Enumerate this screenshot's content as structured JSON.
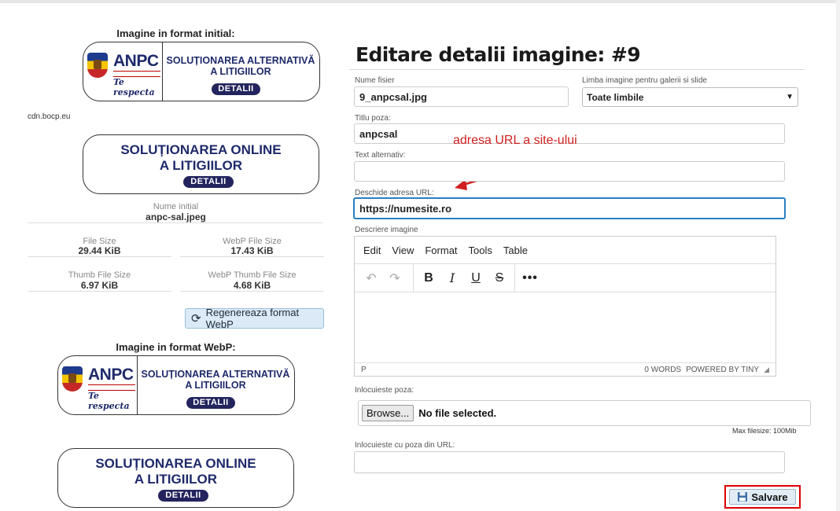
{
  "left": {
    "initial_heading": "Imagine in format initial:",
    "cdn_label": "cdn.bocp.eu",
    "banner1": {
      "brand": "ANPC",
      "tagline": "Te respecta",
      "title_line1": "SOLUȚIONAREA ALTERNATIVĂ",
      "title_line2": "A LITIGIILOR",
      "button": "DETALII"
    },
    "banner2": {
      "title_line1": "SOLUȚIONAREA ONLINE",
      "title_line2": "A LITIGIILOR",
      "button": "DETALII"
    },
    "original_name_label": "Nume initial",
    "original_name_value": "anpc-sal.jpeg",
    "stats": [
      {
        "label": "File Size",
        "value": "29.44 KiB"
      },
      {
        "label": "WebP File Size",
        "value": "17.43 KiB"
      },
      {
        "label": "Thumb File Size",
        "value": "6.97 KiB"
      },
      {
        "label": "WebP Thumb File Size",
        "value": "4.68 KiB"
      }
    ],
    "regen_button": "Regenereaza format WebP",
    "webp_heading": "Imagine in format WebP:",
    "banner3": {
      "brand": "ANPC",
      "tagline": "Te respecta",
      "title_line1": "SOLUȚIONAREA ALTERNATIVĂ",
      "title_line2": "A LITIGIILOR",
      "button": "DETALII"
    },
    "banner4": {
      "title_line1": "SOLUȚIONAREA ONLINE",
      "title_line2": "A LITIGIILOR",
      "button": "DETALII"
    }
  },
  "form": {
    "title": "Editare detalii imagine: #9",
    "filename_label": "Nume fisier",
    "filename_value": "9_anpcsal.jpg",
    "language_label": "Limba imagine pentru galerii si slide",
    "language_value": "Toate limbile",
    "photo_title_label": "Titlu poza:",
    "photo_title_value": "anpcsal",
    "alt_label": "Text alternativ:",
    "alt_value": "",
    "url_label": "Deschide adresa URL:",
    "url_value": "https://numesite.ro",
    "description_label": "Descriere imagine",
    "replace_label": "Inlocuieste poza:",
    "browse_label": "Browse...",
    "no_file_text": "No file selected.",
    "max_filesize": "Max filesize: 100Mib",
    "replace_url_label": "Inlocuieste cu poza din URL:",
    "replace_url_value": "",
    "save_label": "Salvare"
  },
  "editor": {
    "menus": [
      "Edit",
      "View",
      "Format",
      "Tools",
      "Table"
    ],
    "path": "P",
    "word_count": "0 WORDS",
    "powered_by": "POWERED BY TINY"
  },
  "annotation": {
    "text": "adresa URL a site-ului",
    "color": "#d01f1f"
  },
  "colors": {
    "brand_navy": "#1f2a6b",
    "pill": "#23245e",
    "highlight": "#d00000",
    "focus": "#2a7fc0"
  }
}
